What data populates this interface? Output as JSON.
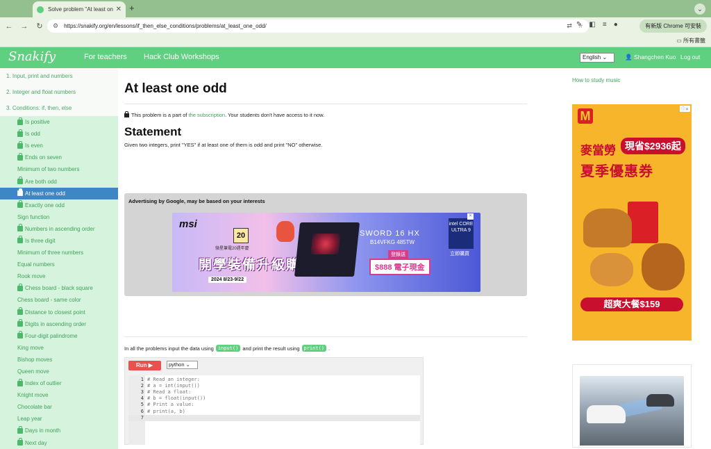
{
  "browser": {
    "tab_title": "Solve problem \"At least one o",
    "url": "https://snakify.org/en/lessons/if_then_else_conditions/problems/at_least_one_odd/",
    "update_label": "有新版 Chrome 可安裝",
    "bookmarks_label": "所有書籤"
  },
  "header": {
    "logo": "Snakify",
    "nav": [
      "For teachers",
      "Hack Club Workshops"
    ],
    "language": "English",
    "user": "Shangchen Kuo",
    "logout": "Log out"
  },
  "sidebar": {
    "sections": [
      "1. Input, print and numbers",
      "2. Integer and float numbers",
      "3. Conditions: if, then, else"
    ],
    "items": [
      {
        "label": "Is positive",
        "locked": true
      },
      {
        "label": "Is odd",
        "locked": true
      },
      {
        "label": "Is even",
        "locked": true
      },
      {
        "label": "Ends on seven",
        "locked": true
      },
      {
        "label": "Minimum of two numbers",
        "locked": false
      },
      {
        "label": "Are both odd",
        "locked": true
      },
      {
        "label": "At least one odd",
        "locked": true,
        "active": true
      },
      {
        "label": "Exactly one odd",
        "locked": true
      },
      {
        "label": "Sign function",
        "locked": false
      },
      {
        "label": "Numbers in ascending order",
        "locked": true
      },
      {
        "label": "Is three digit",
        "locked": true
      },
      {
        "label": "Minimum of three numbers",
        "locked": false
      },
      {
        "label": "Equal numbers",
        "locked": false
      },
      {
        "label": "Rook move",
        "locked": false
      },
      {
        "label": "Chess board - black square",
        "locked": true
      },
      {
        "label": "Chess board - same color",
        "locked": false
      },
      {
        "label": "Distance to closest point",
        "locked": true
      },
      {
        "label": "Digits in ascending order",
        "locked": true
      },
      {
        "label": "Four-digit palindrome",
        "locked": true
      },
      {
        "label": "King move",
        "locked": false
      },
      {
        "label": "Bishop moves",
        "locked": false
      },
      {
        "label": "Queen move",
        "locked": false
      },
      {
        "label": "Index of outlier",
        "locked": true
      },
      {
        "label": "Knight move",
        "locked": false
      },
      {
        "label": "Chocolate bar",
        "locked": false
      },
      {
        "label": "Leap year",
        "locked": false
      },
      {
        "label": "Days in month",
        "locked": true
      },
      {
        "label": "Next day",
        "locked": true
      }
    ]
  },
  "main": {
    "title": "At least one odd",
    "locked_prefix": "This problem is a part of",
    "locked_link": "the subscription",
    "locked_suffix": ". Your students don't have access to it now.",
    "statement_heading": "Statement",
    "statement": "Given two integers, print \"YES\" if at least one of them is odd and print \"NO\" otherwise.",
    "ad_title": "Advertising by Google, may be based on your interests",
    "io_prefix": "In all the problems input the data using",
    "io_input": "input()",
    "io_mid": "and print the result using",
    "io_print": "print()",
    "io_suffix": ".",
    "run_label": "Run ▶",
    "language_select": "python",
    "code_lines": [
      {
        "n": "1",
        "text": "# Read an integer:"
      },
      {
        "n": "2",
        "text": "# a = int(input())"
      },
      {
        "n": "3",
        "text": "# Read a float:"
      },
      {
        "n": "4",
        "text": "# b = float(input())"
      },
      {
        "n": "5",
        "text": "# Print a value:"
      },
      {
        "n": "6",
        "text": "# print(a, b)"
      },
      {
        "n": "7",
        "text": ""
      }
    ]
  },
  "msi_ad": {
    "brand": "msi",
    "anniv": "20",
    "sub": "微星筆電20週年慶",
    "headline": "開學裝備升級購",
    "dates": "2024  8/23-9/22",
    "model": "SWORD 16 HX",
    "model_code": "B14VFKG 485TW",
    "register": "登錄送",
    "cash": "$888 電子現金",
    "intel": "intel CORE ULTRA 9",
    "buy": "立即購買"
  },
  "right": {
    "music_link": "How to study music",
    "mcd_title": "麥當勞",
    "mcd_price": "現省$2936起",
    "mcd_headline": "夏季優惠券",
    "mcd_bar": "超爽大餐$159"
  }
}
